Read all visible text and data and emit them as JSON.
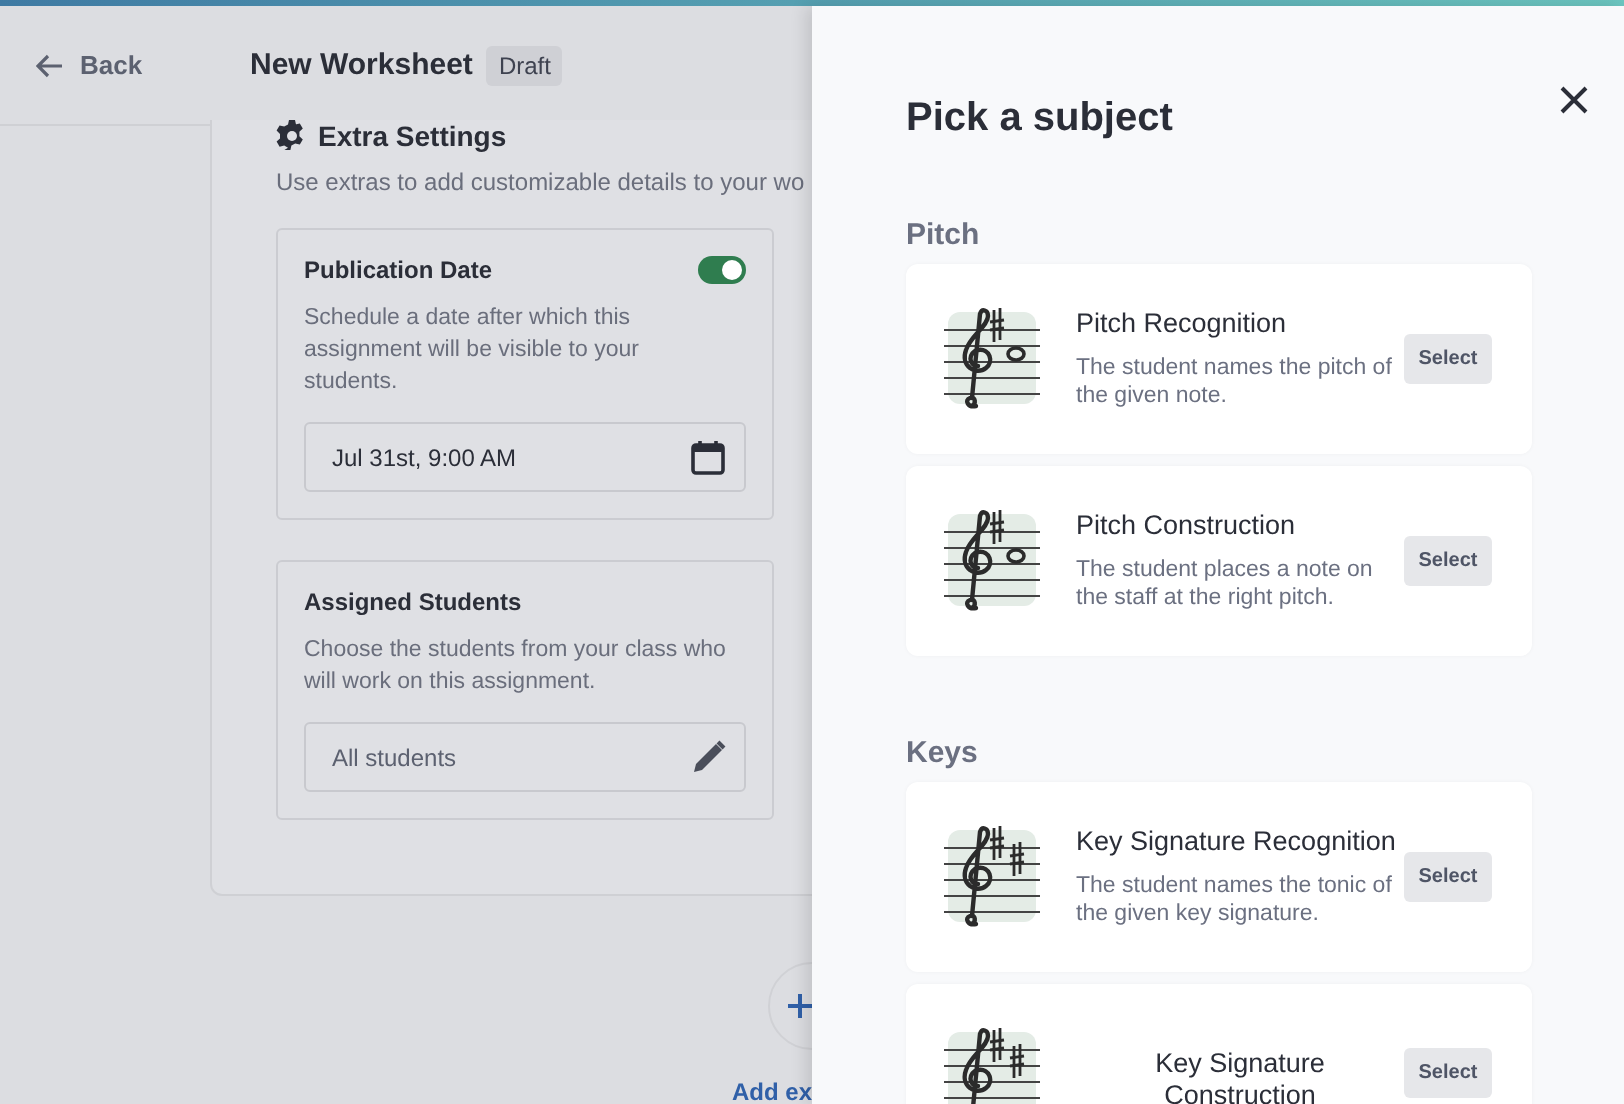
{
  "header": {
    "back": "Back",
    "title": "New Worksheet",
    "badge": "Draft"
  },
  "settings": {
    "title": "Extra Settings",
    "description": "Use extras to add customizable details to your wo",
    "sections": [
      {
        "kind": "date",
        "title": "Publication Date",
        "on": true,
        "description": "Schedule a date after which this assignment will be visible to your students.",
        "value": "Jul 31st, 9:00 AM"
      },
      {
        "kind": "students",
        "title": "Assigned Students",
        "description": "Choose the students from your class who will work on this assignment.",
        "value": "All students"
      }
    ]
  },
  "add_link": "Add ex",
  "drawer": {
    "title": "Pick a subject",
    "groups": [
      {
        "heading": "Pitch",
        "subjects": [
          {
            "kind": "note",
            "title": "Pitch Recognition",
            "description": "The student names the pitch of the given note.",
            "button": "Select"
          },
          {
            "kind": "note",
            "title": "Pitch Construction",
            "description": "The student places a note on the staff at the right pitch.",
            "button": "Select"
          }
        ]
      },
      {
        "heading": "Keys",
        "subjects": [
          {
            "kind": "key",
            "title": "Key Signature Recognition",
            "description": "The student names the tonic of the given key signature.",
            "button": "Select"
          },
          {
            "kind": "key",
            "title": "Key Signature Construction",
            "button": "Select"
          }
        ]
      }
    ]
  }
}
